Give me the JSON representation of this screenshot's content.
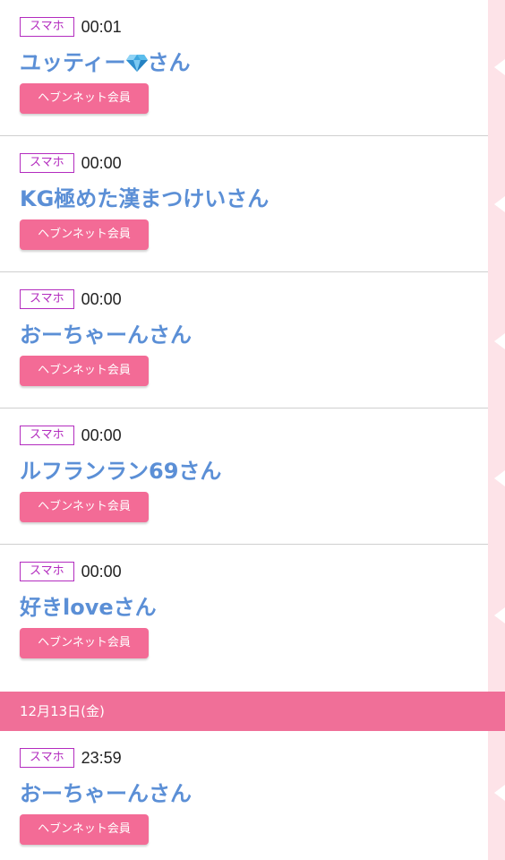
{
  "colors": {
    "accent_pink": "#f36b96",
    "date_bar": "#f06f98",
    "name_blue": "#5b8fd6",
    "badge_purple": "#b32cbf",
    "side_strip": "#fde3e8"
  },
  "entries_before": [
    {
      "device": "スマホ",
      "time": "00:01",
      "name_prefix": "ユッティー",
      "icon": "diamond-icon",
      "name_suffix": "さん",
      "member": "ヘブンネット会員"
    },
    {
      "device": "スマホ",
      "time": "00:00",
      "name": "KG極めた漢まつけいさん",
      "member": "ヘブンネット会員"
    },
    {
      "device": "スマホ",
      "time": "00:00",
      "name": "おーちゃーんさん",
      "member": "ヘブンネット会員"
    },
    {
      "device": "スマホ",
      "time": "00:00",
      "name": "ルフランラン69さん",
      "member": "ヘブンネット会員"
    },
    {
      "device": "スマホ",
      "time": "00:00",
      "name": "好きloveさん",
      "member": "ヘブンネット会員"
    }
  ],
  "date_header": "12月13日(金)",
  "entries_after": [
    {
      "device": "スマホ",
      "time": "23:59",
      "name": "おーちゃーんさん",
      "member": "ヘブンネット会員"
    }
  ]
}
